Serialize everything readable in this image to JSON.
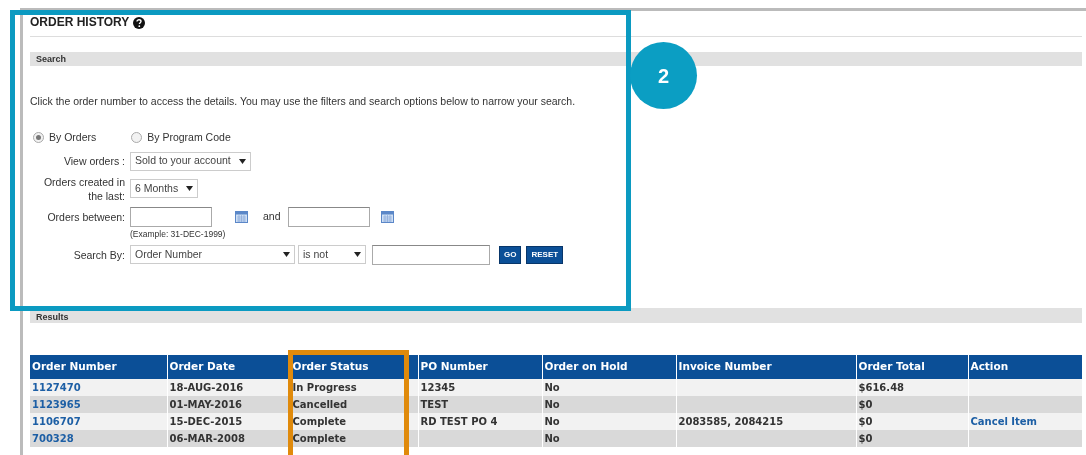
{
  "page": {
    "title": "ORDER HISTORY"
  },
  "search": {
    "heading": "Search",
    "instructions": "Click the order number to access the details. You may use the filters and search options below to narrow your search.",
    "modes": [
      {
        "label": "By Orders",
        "selected": true
      },
      {
        "label": "By Program Code",
        "selected": false
      }
    ],
    "view_orders": {
      "label": "View orders :",
      "value": "Sold to your account"
    },
    "created_in_last": {
      "label": "Orders created in the last:",
      "value": "6 Months"
    },
    "orders_between": {
      "label": "Orders between:",
      "joiner": "and",
      "hint": "(Example: 31-DEC-1999)"
    },
    "search_by": {
      "label": "Search By:",
      "field": "Order Number",
      "operator": "is not",
      "buttons": [
        "GO",
        "RESET"
      ]
    }
  },
  "results": {
    "heading": "Results",
    "table": {
      "columns": [
        "Order Number",
        "Order Date",
        "Order Status",
        "PO Number",
        "Order on Hold",
        "Invoice Number",
        "Order Total",
        "Action"
      ],
      "rows": [
        {
          "cells": [
            "1127470",
            "18-AUG-2016",
            "In Progress",
            "12345",
            "No",
            "",
            "$616.48",
            ""
          ]
        },
        {
          "cells": [
            "1123965",
            "01-MAY-2016",
            "Cancelled",
            "TEST",
            "No",
            "",
            "$0",
            ""
          ]
        },
        {
          "cells": [
            "1106707",
            "15-DEC-2015",
            "Complete",
            "RD TEST PO 4",
            "No",
            "2083585, 2084215",
            "$0",
            "Cancel Item"
          ]
        },
        {
          "cells": [
            "700328",
            "06-MAR-2008",
            "Complete",
            "",
            "No",
            "",
            "$0",
            ""
          ]
        }
      ]
    }
  },
  "callout": {
    "number": "2"
  }
}
